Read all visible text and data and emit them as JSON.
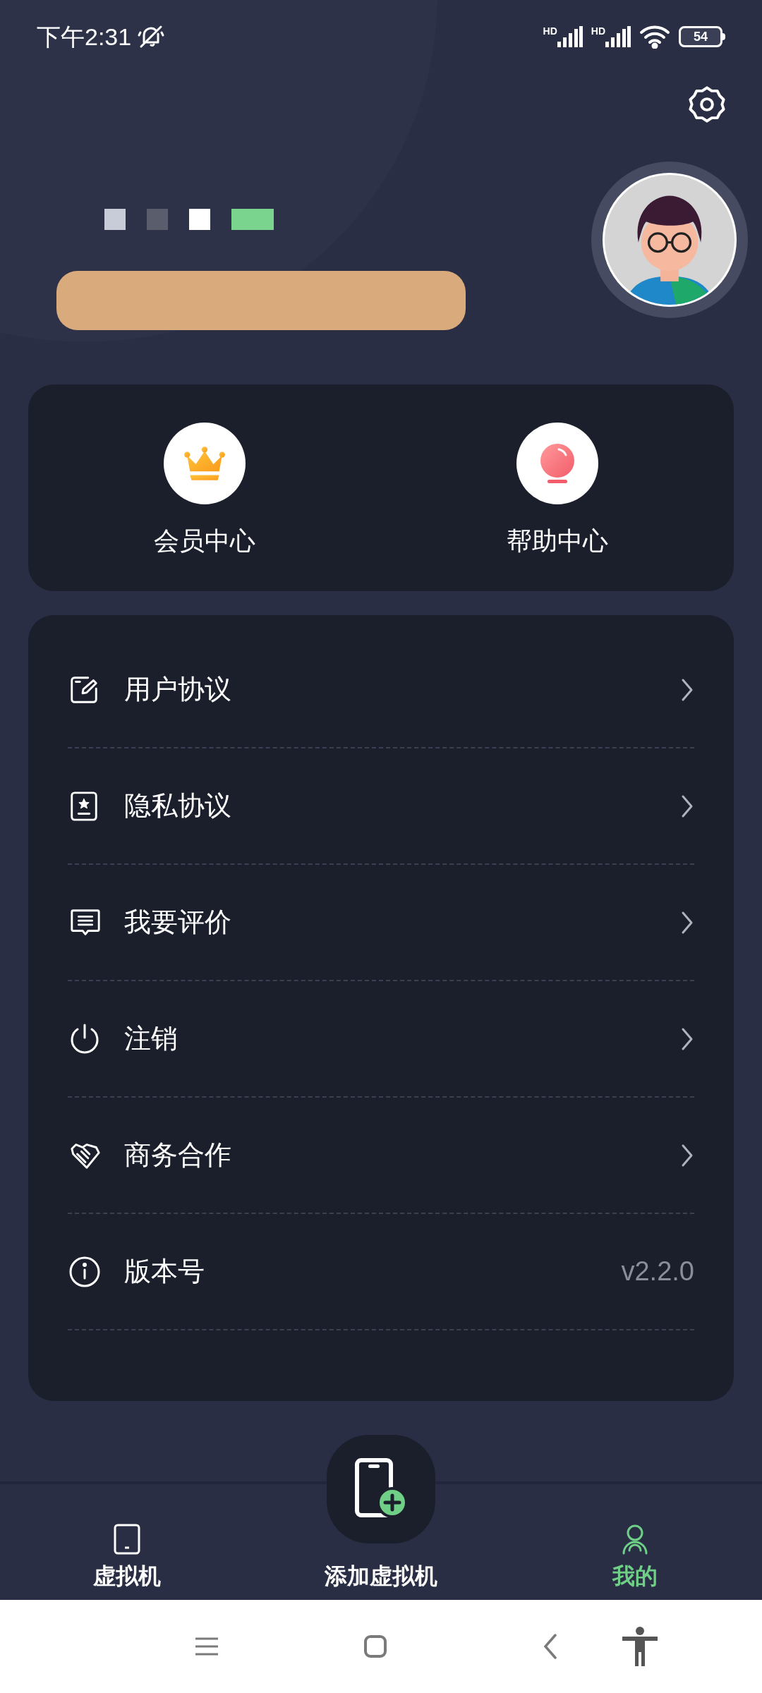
{
  "status_bar": {
    "time": "下午2:31",
    "signal_labels": [
      "HD",
      "HD"
    ],
    "battery": "54"
  },
  "quick_actions": [
    {
      "label": "会员中心",
      "kind": "crown"
    },
    {
      "label": "帮助中心",
      "kind": "bulb"
    }
  ],
  "menu": [
    {
      "label": "用户协议",
      "kind": "edit"
    },
    {
      "label": "隐私协议",
      "kind": "badge"
    },
    {
      "label": "我要评价",
      "kind": "comment"
    },
    {
      "label": "注销",
      "kind": "power"
    },
    {
      "label": "商务合作",
      "kind": "handshake"
    },
    {
      "label": "版本号",
      "kind": "info",
      "value": "v2.2.0"
    }
  ],
  "bottom_nav": [
    {
      "label": "虚拟机",
      "kind": "tablet",
      "selected": false
    },
    {
      "label": "添加虚拟机",
      "kind": "add",
      "selected": false
    },
    {
      "label": "我的",
      "kind": "person",
      "selected": true
    }
  ]
}
